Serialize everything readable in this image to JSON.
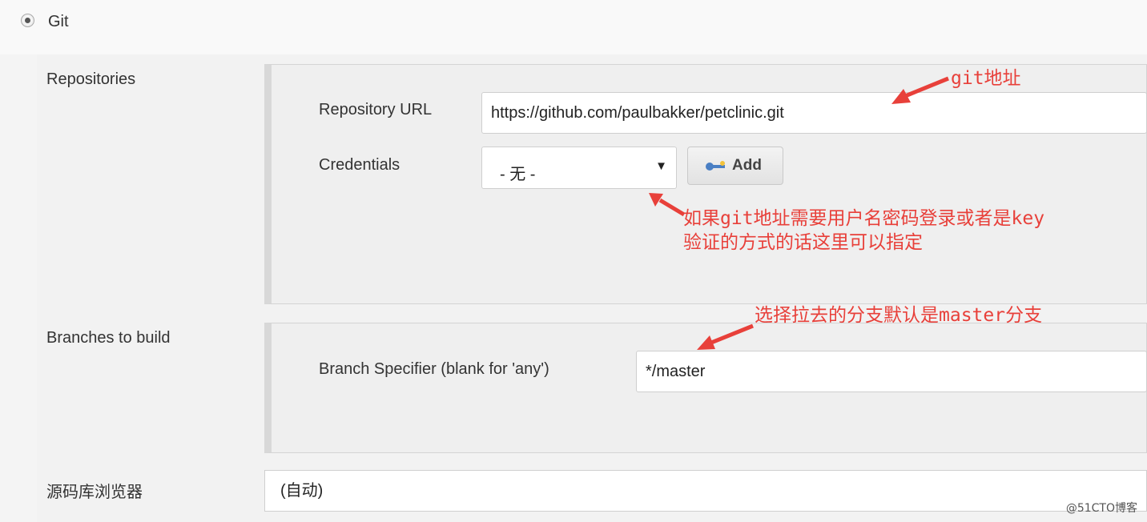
{
  "scm": {
    "option_label": "Git"
  },
  "repositories": {
    "label": "Repositories",
    "url_label": "Repository URL",
    "url_value": "https://github.com/paulbakker/petclinic.git",
    "credentials_label": "Credentials",
    "credentials_value": "- 无 -",
    "add_button_label": "Add"
  },
  "branches": {
    "label": "Branches to build",
    "specifier_label": "Branch Specifier (blank for 'any')",
    "specifier_value": "*/master"
  },
  "repo_browser": {
    "label": "源码库浏览器",
    "value": "(自动)"
  },
  "annotations": {
    "url_note_mono": "git",
    "url_note_text": "地址",
    "cred_note_1a": "如果",
    "cred_note_1b_mono": "git",
    "cred_note_1c": "地址需要用户名密码登录或者是",
    "cred_note_1d_mono": "key",
    "cred_note_2": "验证的方式的话这里可以指定",
    "branch_note_a": "选择拉去的分支默认是",
    "branch_note_b_mono": "master",
    "branch_note_c": "分支"
  },
  "watermark": "@51CTO博客",
  "colors": {
    "annotation": "#e8403a",
    "panel_background": "#efefef",
    "input_border": "#cfcfcf"
  },
  "icons": {
    "scm_radio": "radio-selected",
    "dropdown": "dropdown-arrow-icon",
    "add_button": "key-icon"
  }
}
